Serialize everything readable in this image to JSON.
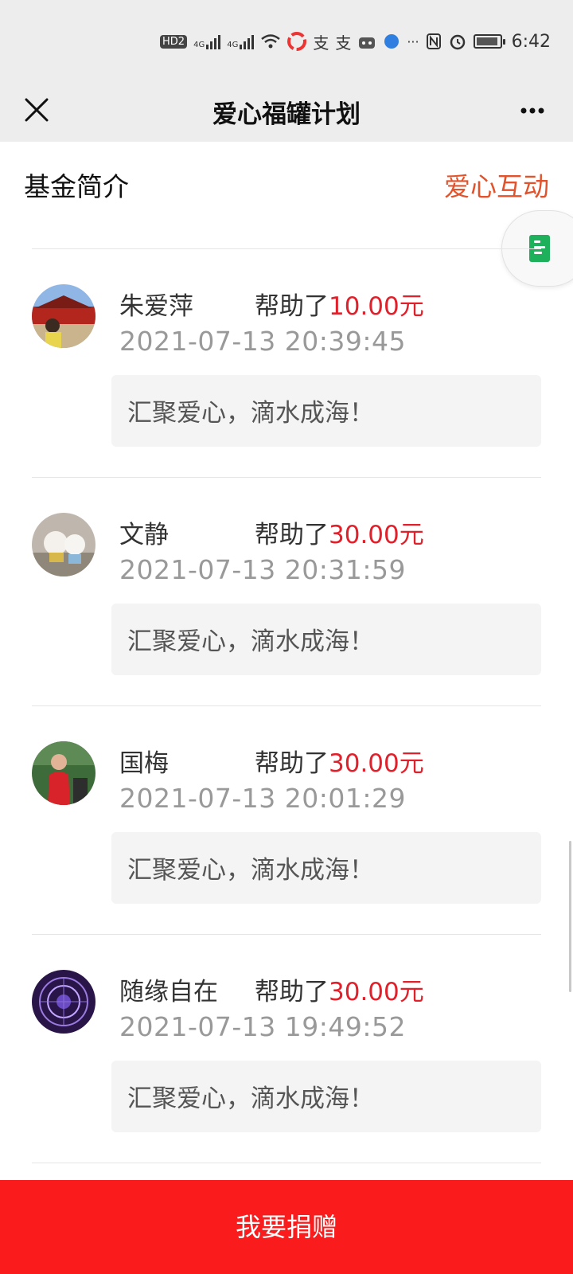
{
  "status_bar": {
    "hd_label": "HD",
    "sim_label": "2",
    "network_1": "4G",
    "network_2": "4G",
    "time": "6:42",
    "icons": [
      "hd-icon",
      "signal-icon",
      "signal-icon",
      "wifi-icon",
      "app-icon",
      "alipay-icon",
      "alipay-icon",
      "app-icon",
      "browser-icon",
      "more-icon",
      "nfc-icon",
      "alarm-icon",
      "battery-icon"
    ]
  },
  "nav": {
    "title": "爱心福罐计划",
    "close_icon": "close-icon",
    "more_icon": "more-icon"
  },
  "tabs": {
    "intro": "基金简介",
    "interact": "爱心互动",
    "interact_color": "#e0532c"
  },
  "float_button": {
    "icon": "document-icon",
    "color": "#1fb05b"
  },
  "donations": [
    {
      "name": "朱爱萍",
      "helped": "帮助了",
      "amount": "10.00元",
      "time": "2021-07-13 20:39:45",
      "message": "汇聚爱心，滴水成海！"
    },
    {
      "name": "文静",
      "helped": "帮助了",
      "amount": "30.00元",
      "time": "2021-07-13 20:31:59",
      "message": "汇聚爱心，滴水成海！"
    },
    {
      "name": "国梅",
      "helped": "帮助了",
      "amount": "30.00元",
      "time": "2021-07-13 20:01:29",
      "message": "汇聚爱心，滴水成海！"
    },
    {
      "name": "随缘自在",
      "helped": "帮助了",
      "amount": "30.00元",
      "time": "2021-07-13 19:49:52",
      "message": "汇聚爱心，滴水成海！"
    }
  ],
  "amount_color": "#e0202a",
  "donate_button": {
    "label": "我要捐赠",
    "color": "#fa1c1c"
  }
}
